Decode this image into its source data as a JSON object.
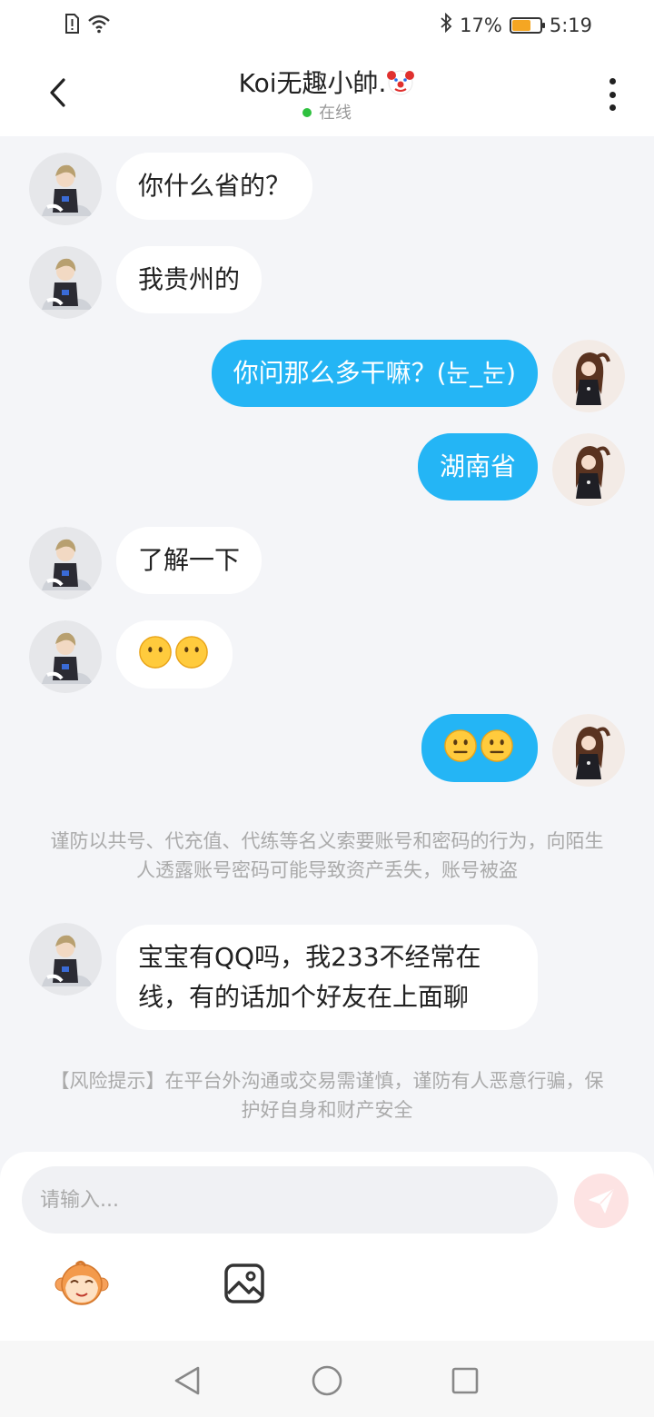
{
  "status_bar": {
    "battery": "17%",
    "battery_level": 0.17,
    "time": "5:19",
    "icons": [
      "sim-alert-icon",
      "wifi-icon",
      "bluetooth-icon",
      "battery-icon"
    ]
  },
  "header": {
    "title": "Koi无趣小帥.",
    "title_emoji": "clown-face-icon",
    "presence": "在线",
    "presence_color": "#2fc13f"
  },
  "colors": {
    "accent": "#24b5f5",
    "incoming_bubble": "#ffffff",
    "background": "#f4f5f8"
  },
  "messages": [
    {
      "side": "in",
      "text": "你什么省的？"
    },
    {
      "side": "in",
      "text": "我贵州的"
    },
    {
      "side": "out",
      "text": "你问那么多干嘛？(눈_눈)"
    },
    {
      "side": "out",
      "text": "湖南省"
    },
    {
      "side": "in",
      "text": "了解一下"
    },
    {
      "side": "in",
      "emoji": [
        "no-mouth-face-icon",
        "no-mouth-face-icon"
      ]
    },
    {
      "side": "out",
      "emoji": [
        "neutral-face-icon",
        "neutral-face-icon"
      ]
    },
    {
      "side": "in",
      "lines": [
        "宝宝有QQ吗，我233不经常在",
        "线，有的话加个好友在上面聊"
      ]
    }
  ],
  "notices": {
    "account_warning": "谨防以共号、代充值、代练等名义索要账号和密码的行为，向陌生人透露账号密码可能导致资产丢失，账号被盗",
    "risk_warning": "【风险提示】在平台外沟通或交易需谨慎，谨防有人恶意行骗，保护好自身和财产安全"
  },
  "input": {
    "placeholder": "请输入..."
  }
}
